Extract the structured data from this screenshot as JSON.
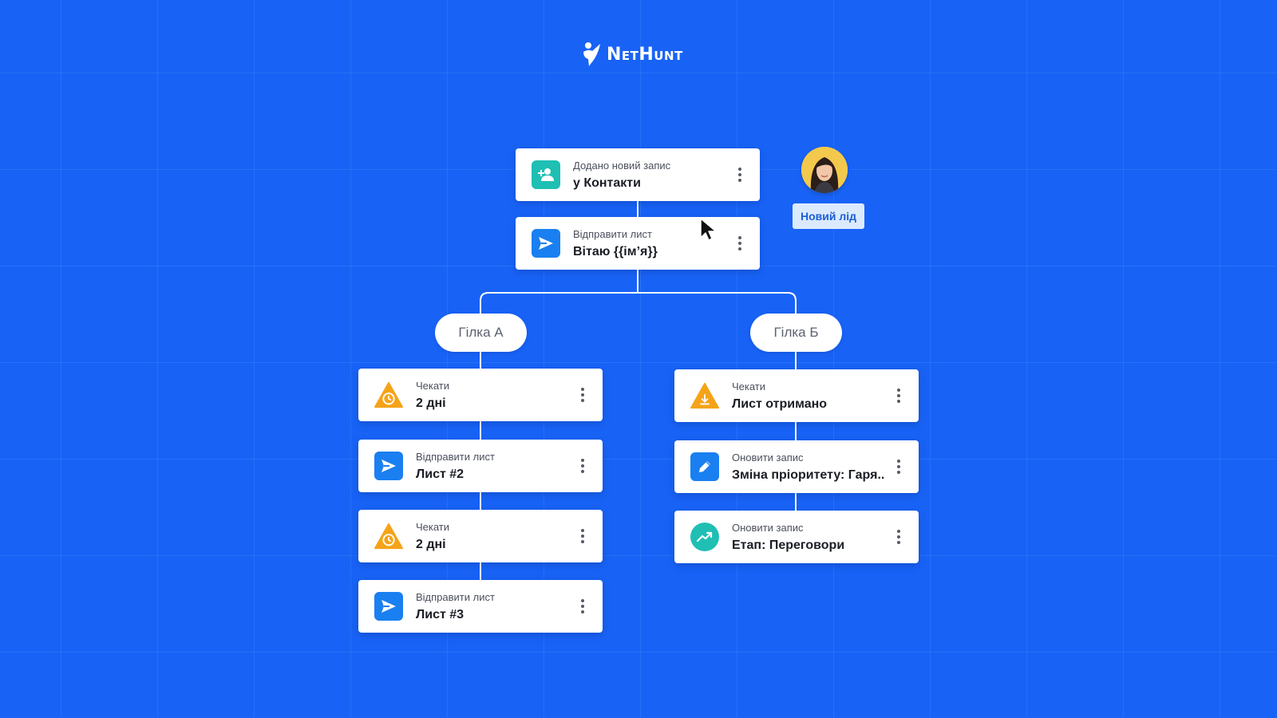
{
  "brand": {
    "name": "NetHunt"
  },
  "colors": {
    "background": "#1863f6",
    "teal": "#1fbfb4",
    "blue": "#1a7ff0",
    "orange": "#f5a318",
    "badge_text": "#1a5fd6"
  },
  "lead": {
    "badge_label": "Новий лід"
  },
  "trigger": {
    "label": "Додано новий запис",
    "value": "у Контакти",
    "icon": "add-user-icon"
  },
  "first_email": {
    "label": "Відправити лист",
    "value": "Вітаю {{ім’я}}",
    "icon": "send-icon"
  },
  "branch_a": {
    "title": "Гілка А",
    "steps": [
      {
        "label": "Чекати",
        "value": "2 дні",
        "icon": "clock-icon"
      },
      {
        "label": "Відправити лист",
        "value": "Лист #2",
        "icon": "send-icon"
      },
      {
        "label": "Чекати",
        "value": "2 дні",
        "icon": "clock-icon"
      },
      {
        "label": "Відправити лист",
        "value": "Лист #3",
        "icon": "send-icon"
      }
    ]
  },
  "branch_b": {
    "title": "Гілка Б",
    "steps": [
      {
        "label": "Чекати",
        "value": "Лист отримано",
        "icon": "download-icon"
      },
      {
        "label": "Оновити запис",
        "value": "Зміна пріоритету: Гаря..",
        "icon": "pencil-icon"
      },
      {
        "label": "Оновити запис",
        "value": "Етап: Переговори",
        "icon": "trend-up-icon"
      }
    ]
  }
}
